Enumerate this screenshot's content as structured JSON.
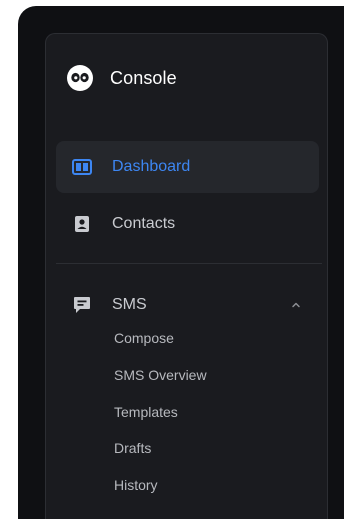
{
  "brand": {
    "title": "Console",
    "logo_icon": "face-logo-icon"
  },
  "nav": {
    "items": [
      {
        "label": "Dashboard",
        "icon": "dashboard-icon",
        "active": true
      },
      {
        "label": "Contacts",
        "icon": "contacts-icon",
        "active": false
      }
    ]
  },
  "sms": {
    "label": "SMS",
    "icon": "message-icon",
    "expanded": true,
    "children": [
      "Compose",
      "SMS Overview",
      "Templates",
      "Drafts",
      "History"
    ]
  },
  "colors": {
    "accent": "#3d86f2",
    "sidebar_bg": "#1a1b1f",
    "shell_bg": "#0f1013",
    "active_bg": "#25272c",
    "text": "#c9cbd0"
  }
}
